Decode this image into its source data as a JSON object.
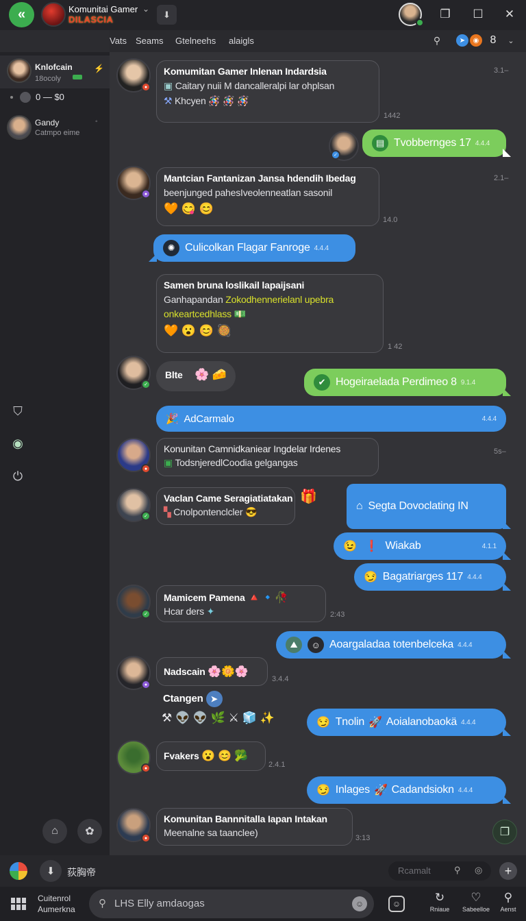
{
  "window": {
    "group_title": "Komunitai Gamer",
    "group_logo_text": "DILASCIA",
    "me_status_color": "#3cad4f"
  },
  "tabs": [
    "Vats",
    "Seams",
    "Gtelneehs",
    "alaigls"
  ],
  "tab_tools": {
    "count": "8"
  },
  "sidebar": {
    "contacts": [
      {
        "name": "Knlofcain",
        "sub": "18ocoly"
      },
      {
        "name": "Gandy",
        "sub": "Catmpo eime"
      }
    ],
    "balance": "0 — $0"
  },
  "messages": {
    "m1": {
      "sender": "Komumitan Gamer Inlenan Indardsia",
      "line": "Caitary nuii M dancalleralpi lar ohplsan",
      "emoji_text": "Khcyen",
      "emojis": "🪅 🪅 🪅",
      "time_right": "3.1–",
      "time_below": "1442"
    },
    "m2": {
      "text": "Tvobbernges 17",
      "tick": "4.4.4"
    },
    "m3": {
      "sender": "Mantcian Fantanizan Jansa hdendih Ibedag",
      "line": "beenjunged pahesIveolenneatlan sasonil",
      "emojis": "🧡 😋 😊",
      "time_right": "2.1–",
      "time_below": "14.0"
    },
    "m4": {
      "text": "Culicolkan Flagar Fanroge",
      "tick": "4.4.4"
    },
    "m5": {
      "sender": "Samen bruna loslikail lapaijsani",
      "line1_a": "Ganhapandan ",
      "line1_b": "Zokodhennerielanl upebra",
      "line2": "onkeartcedhlass",
      "emojis": "🧡 😮 😊 🥘",
      "time": "1 42"
    },
    "m6": {
      "sender": "Blte",
      "emojis": "🌸 🧀"
    },
    "m7": {
      "text": "Hogeiraelada Perdimeo 8",
      "tick": "9.1.4"
    },
    "m8": {
      "text": "AdCarmalo",
      "tick": "4.4.4"
    },
    "m9": {
      "sender": "Konunitan Camnidkaniear Ingdelar Irdenes",
      "line": "TodsnjeredlCoodia gelgangas",
      "time_right": "5s–"
    },
    "m10": {
      "sender": "Vaclan Came Seragiatiatakan",
      "line": "Cnolpontenclcler",
      "emoji_after": "😎"
    },
    "m11": {
      "text": "Segta Dovoclating IN"
    },
    "m12": {
      "text": "Wiakab",
      "tick": "4.1.1"
    },
    "m13": {
      "text": "Bagatriarges 117",
      "tick": "4.4.4"
    },
    "m14": {
      "sender": "Mamicem Pamena",
      "line": "Hcar ders",
      "time": "2:43"
    },
    "m15": {
      "text": "Aoargaladaa totenbelceka",
      "tick": "4.4.4"
    },
    "m16": {
      "sender": "Nadscain",
      "time": "3.4.4"
    },
    "m17": {
      "sender": "Ctangen"
    },
    "m18": {
      "text_a": "Tnolin",
      "text_b": "Aoialanobaokä",
      "tick": "4.4.4"
    },
    "m19": {
      "sender": "Fvakers",
      "emojis": "😮 😊 🥦",
      "time": "2.4.1"
    },
    "m20": {
      "text_a": "Inlages",
      "text_b": "Cadandsiokn",
      "tick": "4.4.4"
    },
    "m21": {
      "sender": "Komunitan Bannnitalla Iapan Intakan",
      "line": "Meenalne sa taanclee)",
      "time": "3:13"
    }
  },
  "compose": {
    "label": "荻胸帝",
    "search_placeholder": "Rcamalt"
  },
  "bottom": {
    "name_line1": "Cuitenrol",
    "name_line2": "Aumerkna",
    "input_placeholder": "LHS Elly amdaogas",
    "actions": [
      "Rniaue",
      "Sabeelloe",
      "Aenst"
    ]
  },
  "colors": {
    "accent_green": "#3cad4f",
    "bubble_blue": "#3d8fe3",
    "bubble_green": "#7ccd5c",
    "chat_bg": "#333337"
  }
}
